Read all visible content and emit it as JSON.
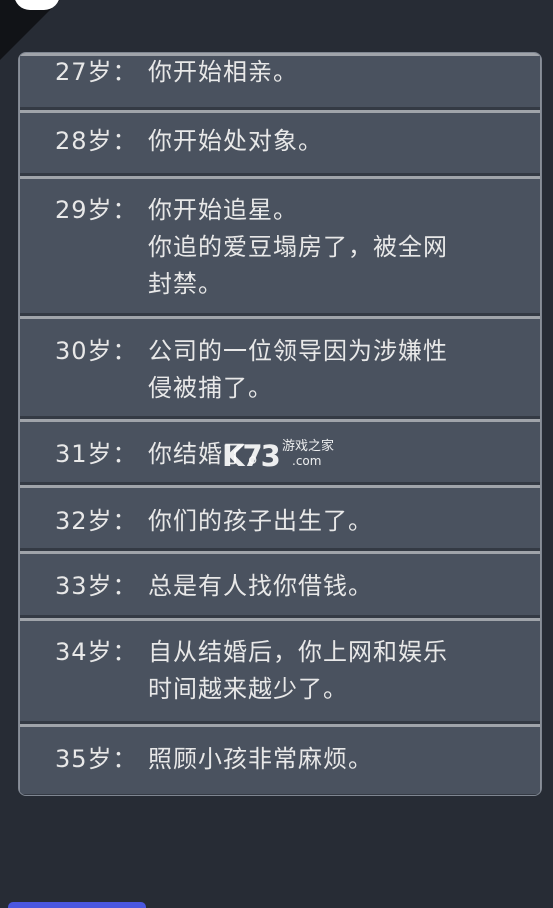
{
  "timeline": [
    {
      "age": "27岁：",
      "events": [
        "你开始相亲。"
      ]
    },
    {
      "age": "28岁：",
      "events": [
        "你开始处对象。"
      ]
    },
    {
      "age": "29岁：",
      "events": [
        "你开始追星。",
        "你追的爱豆塌房了，被全网\n封禁。"
      ]
    },
    {
      "age": "30岁：",
      "events": [
        "公司的一位领导因为涉嫌性\n侵被捕了。"
      ]
    },
    {
      "age": "31岁：",
      "events": [
        "你结婚了。"
      ]
    },
    {
      "age": "32岁：",
      "events": [
        "你们的孩子出生了。"
      ]
    },
    {
      "age": "33岁：",
      "events": [
        "总是有人找你借钱。"
      ]
    },
    {
      "age": "34岁：",
      "events": [
        "自从结婚后，你上网和娱乐\n时间越来越少了。"
      ]
    },
    {
      "age": "35岁：",
      "events": [
        "照顾小孩非常麻烦。"
      ]
    }
  ],
  "watermark": {
    "brand": "K73",
    "tagline": "游戏之家",
    "domain": ".com"
  },
  "colors": {
    "background": "#272c35",
    "row": "#4a525f",
    "text": "#e8e8e8",
    "button": "#4b57df"
  }
}
